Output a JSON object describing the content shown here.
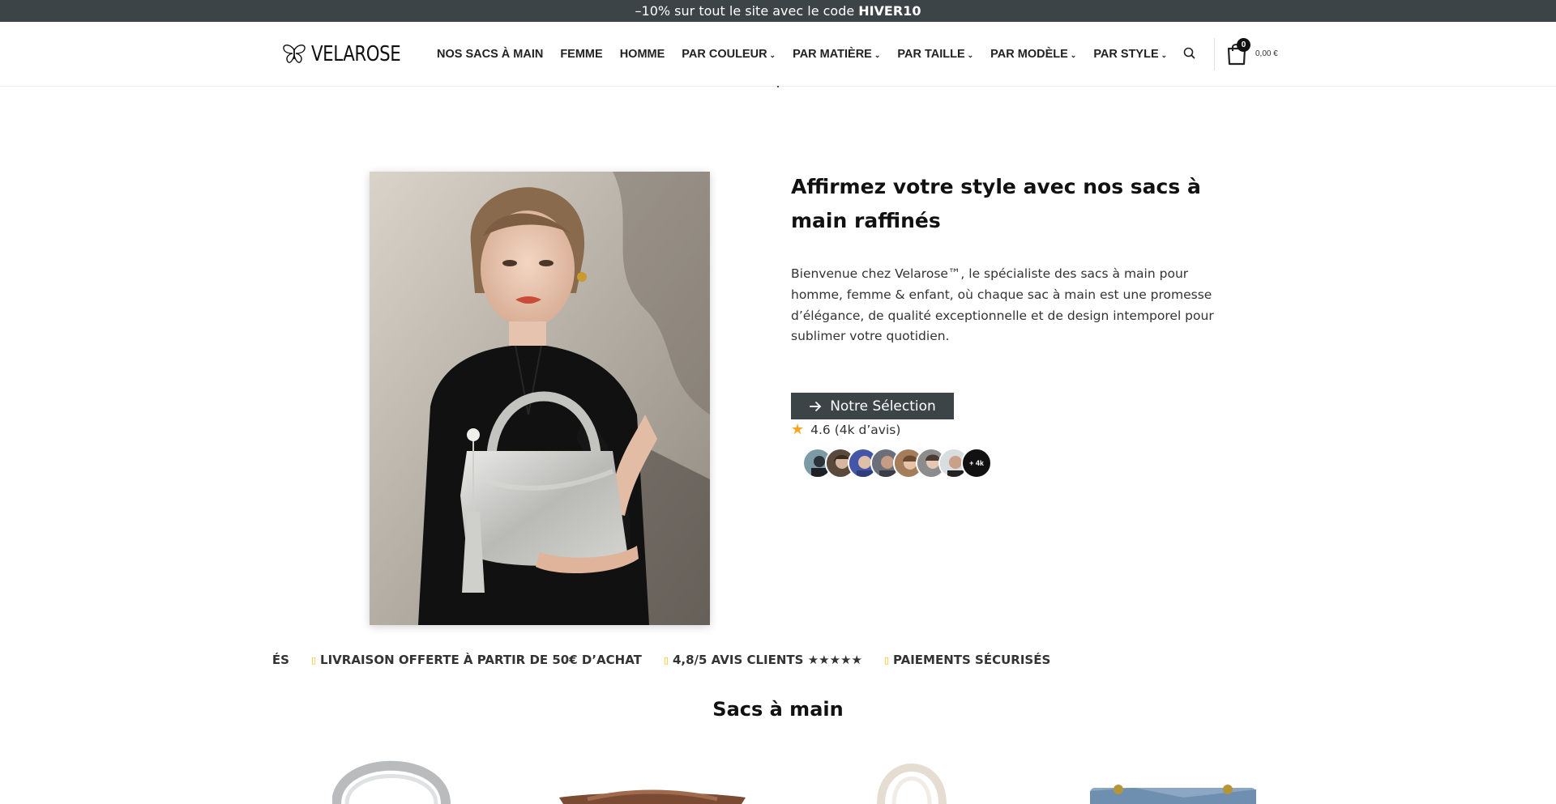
{
  "announcement": {
    "text": "–10% sur tout le site avec le code",
    "code": "HIVER10"
  },
  "brand": {
    "name": "VELAROSE"
  },
  "nav": {
    "items": [
      {
        "label": "NOS SACS À MAIN",
        "has_dropdown": false
      },
      {
        "label": "FEMME",
        "has_dropdown": false
      },
      {
        "label": "HOMME",
        "has_dropdown": false
      },
      {
        "label": "PAR COULEUR",
        "has_dropdown": true
      },
      {
        "label": "PAR MATIÈRE",
        "has_dropdown": true
      },
      {
        "label": "PAR TAILLE",
        "has_dropdown": true
      },
      {
        "label": "PAR MODÈLE",
        "has_dropdown": true
      },
      {
        "label": "PAR STYLE",
        "has_dropdown": true
      }
    ]
  },
  "cart": {
    "count": "0",
    "total": "0,00 €"
  },
  "hero": {
    "title": "Affirmez votre style avec nos sacs à main raffinés",
    "description": "Bienvenue chez Velarose™, le spécialiste des sacs à main pour homme, femme & enfant, où chaque sac à main est une promesse d’élégance, de qualité exceptionnelle et de design intemporel pour sublimer votre quotidien.",
    "cta_label": "Notre Sélection",
    "rating_text": "4.6 (4k d’avis)",
    "avatars_more": "+ 4k"
  },
  "marquee": {
    "items": [
      {
        "text": "RISÉS",
        "marked": false
      },
      {
        "text": "LIVRAISON OFFERTE À PARTIR DE 50€ D’ACHAT",
        "marked": true
      },
      {
        "text": "4,8/5 AVIS CLIENTS ★★★★★",
        "marked": true
      },
      {
        "text": "PAIEMENTS SÉCURISÉS",
        "marked": true
      }
    ]
  },
  "section": {
    "title": "Sacs à main"
  },
  "colors": {
    "announcement_bg": "#3c4447",
    "cta_bg": "#3c4447",
    "star": "#f5a623",
    "marquee_marker": "#f5b800"
  },
  "icons": {
    "logo": "butterfly-icon",
    "search": "search-icon",
    "cart": "shopping-bag-icon",
    "cta": "arrow-right-icon",
    "rating": "star-icon"
  }
}
